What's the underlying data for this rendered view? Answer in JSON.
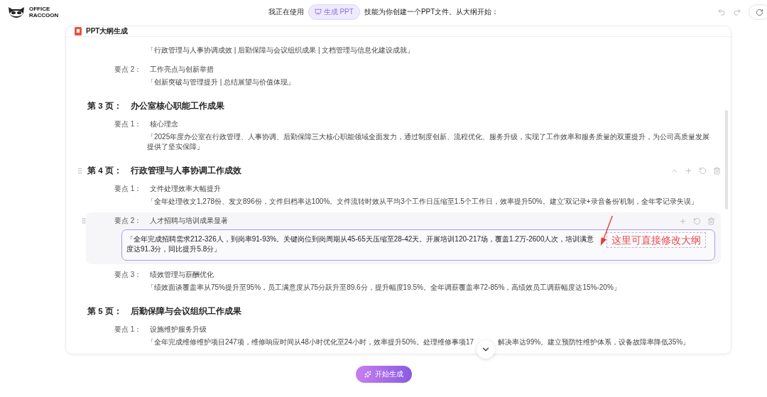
{
  "header": {
    "logo": [
      "OFFICE",
      "RACCOON"
    ],
    "message_before": "我正在使用",
    "skill": "生成 PPT",
    "message_after": "技能为你创建一个PPT文件。从大纲开始："
  },
  "card": {
    "title": "PPT大纲生成",
    "pages": [
      {
        "points": [
          {
            "text": "「行政管理与人事协调成效 | 后勤保障与会议组织成果 | 文档管理与信息化建设成就」"
          },
          {
            "label": "要点 2：",
            "title": "工作亮点与创新举措",
            "text": "「创新突破与管理提升 | 总结展望与价值体现」",
            "editing": false
          }
        ]
      },
      {
        "heading": {
          "number": "第 3 页：",
          "title": "办公室核心职能工作成果"
        },
        "hovered": false,
        "points": [
          {
            "label": "要点 1：",
            "title": "核心理念",
            "text": "「2025年度办公室在行政管理、人事协调、后勤保障三大核心职能领域全面发力，通过制度创新、流程优化、服务升级，实现了工作效率和服务质量的双重提升，为公司高质量发展提供了坚实保障」",
            "editing": false
          }
        ]
      },
      {
        "heading": {
          "number": "第 4 页：",
          "title": "行政管理与人事协调工作成效"
        },
        "hovered": true,
        "points": [
          {
            "label": "要点 1：",
            "title": "文件处理效率大幅提升",
            "text": "「全年处理收文1,278份、发文896份，文件归档率达100%。文件流转时效从平均3个工作日压缩至1.5个工作日，效率提升50%。建立'双记录+录音备份'机制，全年零记录失误」",
            "editing": false
          },
          {
            "label": "要点 2：",
            "title": "人才招聘与培训成果显著",
            "text": "「全年完成招聘需求212-326人，到岗率91-93%。关键岗位到岗周期从45-65天压缩至28-42天。开展培训120-217场，覆盖1.2万-2600人次，培训满意度达91.3分，同比提升5.8分」",
            "editing": true
          },
          {
            "label": "要点 3：",
            "title": "绩效管理与薪酬优化",
            "text": "「绩效面谈覆盖率从75%提升至95%，员工满意度从75分跃升至89.6分，提升幅度19.5%。全年调薪覆盖率72-85%，高绩效员工调薪幅度达15%-20%」",
            "editing": false
          }
        ]
      },
      {
        "heading": {
          "number": "第 5 页：",
          "title": "后勤保障与会议组织工作成果"
        },
        "hovered": false,
        "points": [
          {
            "label": "要点 1：",
            "title": "设施维护服务升级",
            "text": "「全年完成维修维护项目247项，维修响应时间从48小时优化至24小时，效率提升50%。处理维修事项17",
            "text_after": "解决率达99%。建立预防性维护体系，设备故障率降低35%」",
            "editing": false
          }
        ]
      }
    ]
  },
  "annotation": {
    "text": "这里可直接修改大纲"
  },
  "start_button": "开始生成"
}
